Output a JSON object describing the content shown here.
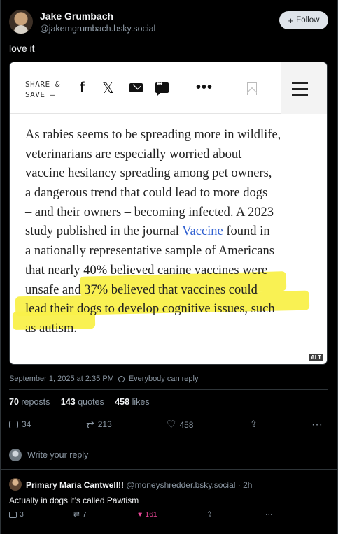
{
  "post": {
    "author_name": "Jake Grumbach",
    "author_handle": "@jakemgrumbach.bsky.social",
    "follow_label": "Follow",
    "text": "love it",
    "timestamp": "September 1, 2025 at 2:35 PM",
    "visibility": "Everybody can reply",
    "stats": {
      "reposts": "70",
      "reposts_label": "reposts",
      "quotes": "143",
      "quotes_label": "quotes",
      "likes": "458",
      "likes_label": "likes"
    },
    "actions": {
      "replies": "34",
      "reposts": "213",
      "likes": "458"
    }
  },
  "embed": {
    "share_label": "SHARE &\nSAVE —",
    "alt_badge": "ALT",
    "article_lines": [
      {
        "text": "As rabies seems to be spreading more in wildlife,"
      },
      {
        "text": "veterinarians are especially worried about"
      },
      {
        "text": "vaccine hesitancy spreading among pet owners,"
      },
      {
        "text": "a dangerous trend that could lead to more dogs"
      },
      {
        "text": "– and their owners – becoming infected. A 2023"
      },
      {
        "pre": "study published in the journal ",
        "link": "Vaccine",
        "post": " found in"
      },
      {
        "text": "a nationally representative sample of Americans"
      },
      {
        "text": "that nearly 40% believed canine vaccines were"
      },
      {
        "text": "unsafe and 37% believed that vaccines could"
      },
      {
        "text": "lead their dogs to develop cognitive issues, such"
      },
      {
        "text": "as autism."
      }
    ],
    "highlight_color": "#f9f04a",
    "link_color": "#2f5fd0",
    "icons": [
      "facebook-icon",
      "x-icon",
      "mail-icon",
      "chat-icon",
      "more-icon",
      "bookmark-icon",
      "hamburger-icon"
    ]
  },
  "composer": {
    "placeholder": "Write your reply"
  },
  "reply": {
    "author_name": "Primary Maria Cantwell!!",
    "author_handle": "@moneyshredder.bsky.social",
    "age": "2h",
    "text": "Actually in dogs it’s called Pawtism",
    "replies": "3",
    "reposts": "7",
    "likes": "161"
  },
  "colors": {
    "background": "#000000",
    "muted": "#8c98a4",
    "like_active": "#ec4899",
    "border": "#2e3438"
  }
}
